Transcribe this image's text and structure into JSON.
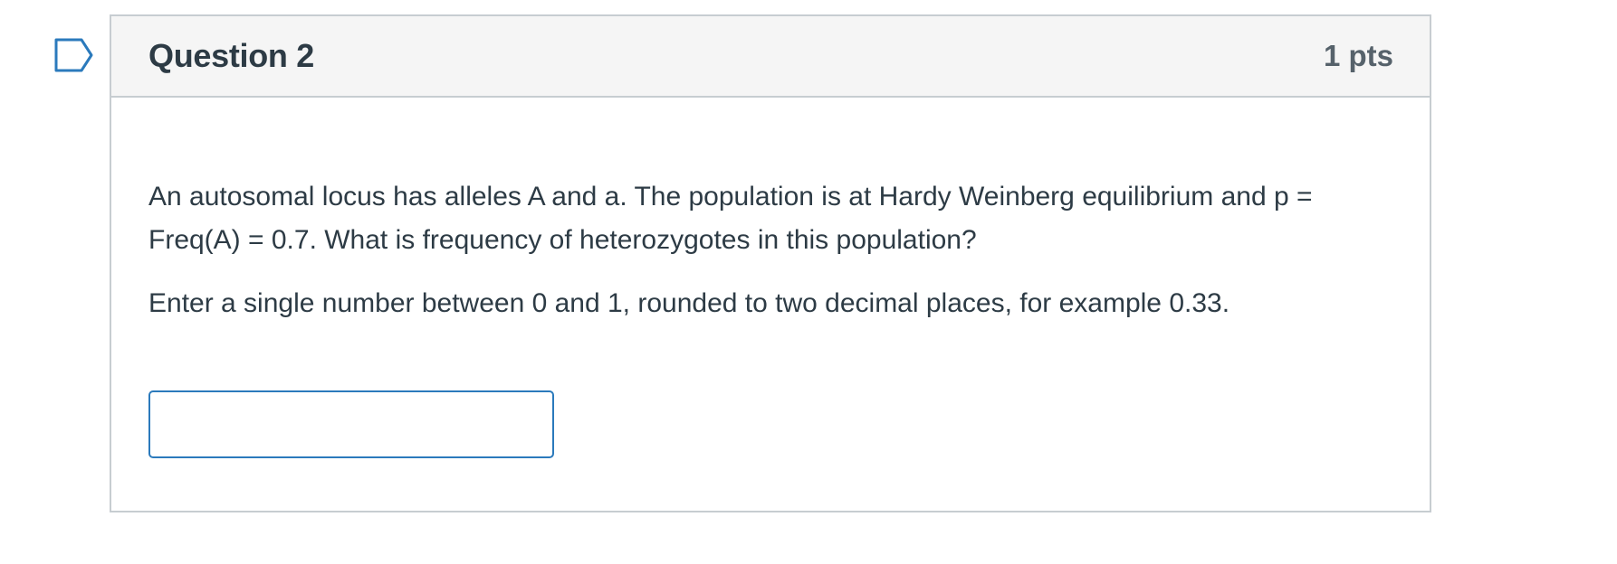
{
  "question": {
    "title": "Question 2",
    "points": "1 pts",
    "text": "An autosomal locus has alleles A and a. The population is at Hardy Weinberg equilibrium and  p = Freq(A) = 0.7. What is frequency of heterozygotes in this population?",
    "instructions": "Enter a single number between 0 and 1, rounded to two decimal places, for example 0.33.",
    "answer": {
      "value": "",
      "placeholder": ""
    }
  },
  "colors": {
    "header_bg": "#f5f5f5",
    "border": "#c7cdd1",
    "text": "#2d3b45",
    "input_border": "#2b7abc",
    "flag_outline": "#2b7abc"
  },
  "icons": {
    "flag": "bookmark-flag-icon"
  }
}
